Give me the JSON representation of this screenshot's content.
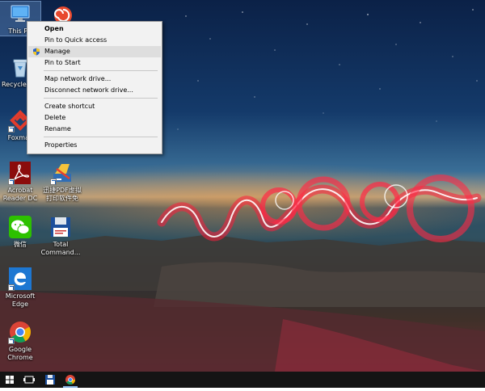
{
  "desktop_icons": [
    {
      "id": "this-pc",
      "label": "This PC"
    },
    {
      "id": "recycle-bin",
      "label": "Recycle Bin"
    },
    {
      "id": "foxmail",
      "label": "Foxmail"
    },
    {
      "id": "acrobat",
      "label": "Acrobat Reader DC"
    },
    {
      "id": "pdf-tool",
      "label": "迅捷PDF虚拟打印软件免"
    },
    {
      "id": "wechat",
      "label": "微信"
    },
    {
      "id": "total-commander",
      "label": "Total Command..."
    },
    {
      "id": "edge",
      "label": "Microsoft Edge"
    },
    {
      "id": "chrome",
      "label": "Google Chrome"
    }
  ],
  "context_menu": {
    "items": {
      "open": "Open",
      "pin_quick": "Pin to Quick access",
      "manage": "Manage",
      "pin_start": "Pin to Start",
      "map_drive": "Map network drive...",
      "disconnect_drive": "Disconnect network drive...",
      "create_shortcut": "Create shortcut",
      "delete": "Delete",
      "rename": "Rename",
      "properties": "Properties"
    },
    "highlighted": "manage",
    "default_item": "open"
  },
  "taskbar": {
    "buttons": [
      "start-windows-icon",
      "task-view-icon",
      "total-commander-icon",
      "chrome-icon"
    ],
    "active": "chrome-icon",
    "colors": {
      "background": "#141414",
      "active_indicator": "#8ab4e8"
    }
  },
  "colors": {
    "menu_bg": "#f2f2f2",
    "menu_highlight": "#dedede",
    "light_painting": "#ff1e3c"
  }
}
